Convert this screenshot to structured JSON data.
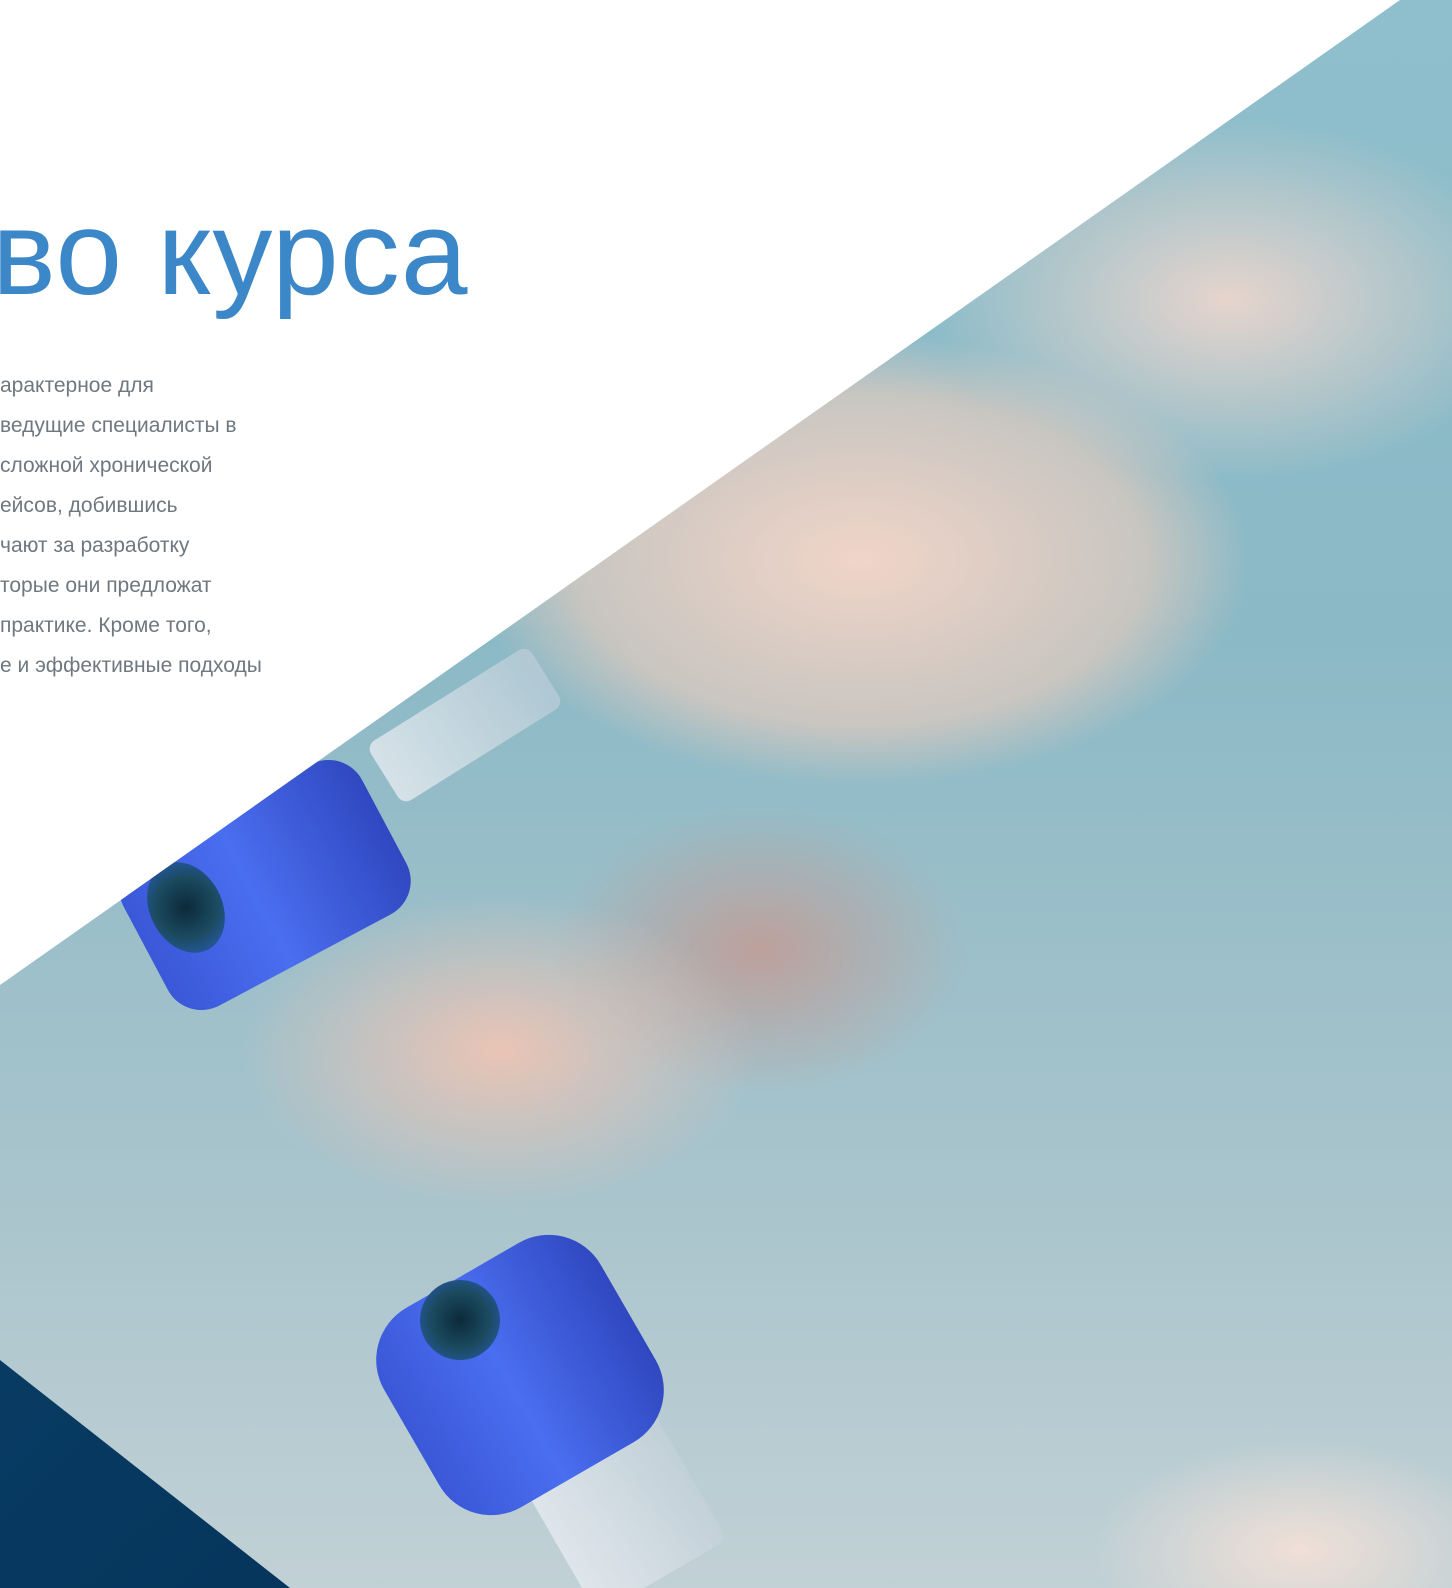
{
  "hero": {
    "title": "во курса",
    "description_lines": [
      "арактерное для",
      "ведущие специалисты в",
      "сложной хронической",
      "ейсов, добившись",
      "чают за разработку",
      "торые они предложат",
      "практике. Кроме того,",
      "е и эффективные подходы"
    ]
  },
  "colors": {
    "title": "#3b87c7",
    "body_text": "#6f7880",
    "dark_corner": "#06365c",
    "cap_blue": "#4a6ef0"
  }
}
